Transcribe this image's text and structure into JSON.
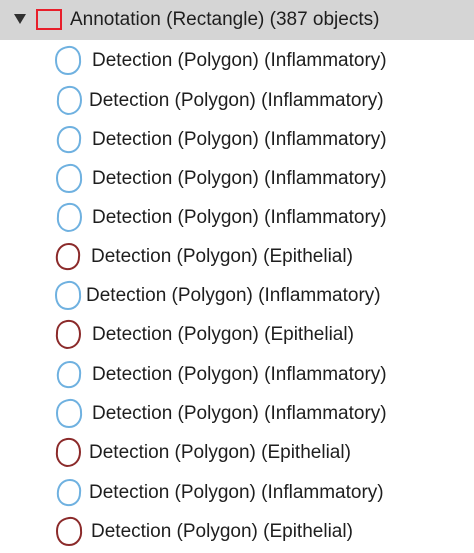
{
  "tree": {
    "parent": {
      "label": "Annotation (Rectangle) (387 objects)",
      "icon": "rectangle-annotation-icon",
      "icon_color": "#e81f2b",
      "expanded": true
    },
    "children": [
      {
        "label": "Detection (Polygon) (Inflammatory)",
        "class": "Inflammatory",
        "icon": "polygon-detection-icon",
        "color": "#6fb1e0"
      },
      {
        "label": "Detection (Polygon) (Inflammatory)",
        "class": "Inflammatory",
        "icon": "polygon-detection-icon",
        "color": "#6fb1e0"
      },
      {
        "label": "Detection (Polygon) (Inflammatory)",
        "class": "Inflammatory",
        "icon": "polygon-detection-icon",
        "color": "#6fb1e0"
      },
      {
        "label": "Detection (Polygon) (Inflammatory)",
        "class": "Inflammatory",
        "icon": "polygon-detection-icon",
        "color": "#6fb1e0"
      },
      {
        "label": "Detection (Polygon) (Inflammatory)",
        "class": "Inflammatory",
        "icon": "polygon-detection-icon",
        "color": "#6fb1e0"
      },
      {
        "label": "Detection (Polygon) (Epithelial)",
        "class": "Epithelial",
        "icon": "polygon-detection-icon",
        "color": "#8b2a2a"
      },
      {
        "label": "Detection (Polygon) (Inflammatory)",
        "class": "Inflammatory",
        "icon": "polygon-detection-icon",
        "color": "#6fb1e0"
      },
      {
        "label": "Detection (Polygon) (Epithelial)",
        "class": "Epithelial",
        "icon": "polygon-detection-icon",
        "color": "#8b2a2a"
      },
      {
        "label": "Detection (Polygon) (Inflammatory)",
        "class": "Inflammatory",
        "icon": "polygon-detection-icon",
        "color": "#6fb1e0"
      },
      {
        "label": "Detection (Polygon) (Inflammatory)",
        "class": "Inflammatory",
        "icon": "polygon-detection-icon",
        "color": "#6fb1e0"
      },
      {
        "label": "Detection (Polygon) (Epithelial)",
        "class": "Epithelial",
        "icon": "polygon-detection-icon",
        "color": "#8b2a2a"
      },
      {
        "label": "Detection (Polygon) (Inflammatory)",
        "class": "Inflammatory",
        "icon": "polygon-detection-icon",
        "color": "#6fb1e0"
      },
      {
        "label": "Detection (Polygon) (Epithelial)",
        "class": "Epithelial",
        "icon": "polygon-detection-icon",
        "color": "#8b2a2a"
      }
    ]
  }
}
